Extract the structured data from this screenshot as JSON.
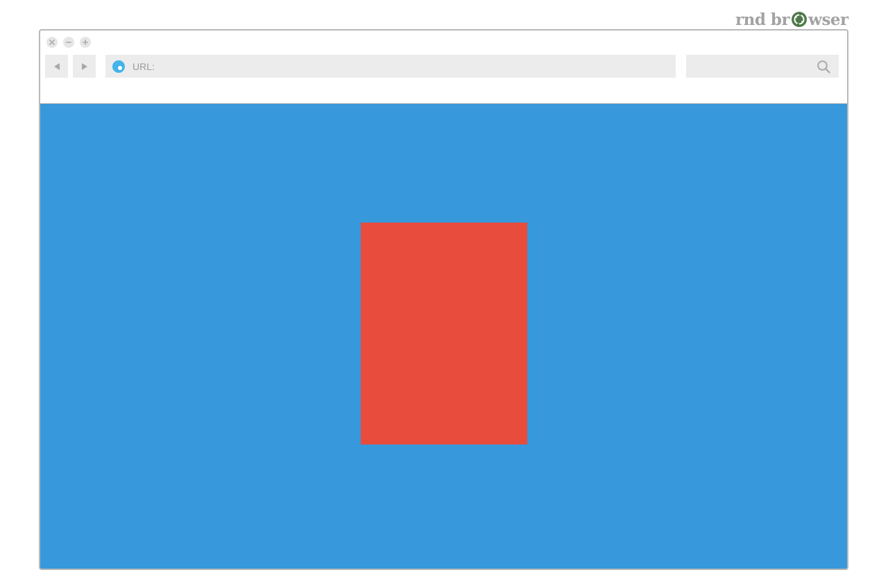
{
  "brand": {
    "text_before": "rnd br",
    "text_after": "wser",
    "logo_icon": "recycle-arrows-circle-icon",
    "logo_color": "#4e7a4a"
  },
  "window": {
    "controls": [
      "close-icon",
      "minimize-icon",
      "maximize-icon"
    ]
  },
  "toolbar": {
    "back_icon": "triangle-left-icon",
    "forward_icon": "triangle-right-icon",
    "url_label": "URL:",
    "url_icon": "globe-icon",
    "search_icon": "search-icon"
  },
  "page": {
    "background_color": "#3798db",
    "rect_color": "#e74c3c"
  }
}
